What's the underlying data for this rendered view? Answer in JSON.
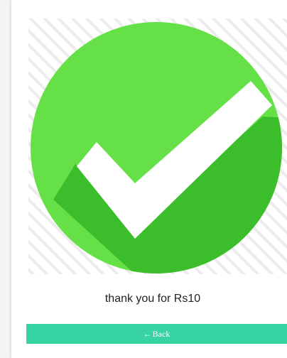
{
  "confirmation": {
    "icon": "check-mark-icon",
    "message": "thank you for Rs10"
  },
  "actions": {
    "back_arrow": "←",
    "back_label": "Back"
  },
  "colors": {
    "check_green": "#65e046",
    "check_shadow": "#3cbd2b",
    "accent": "#38d3a3",
    "hatch": "#e9e9e9"
  }
}
